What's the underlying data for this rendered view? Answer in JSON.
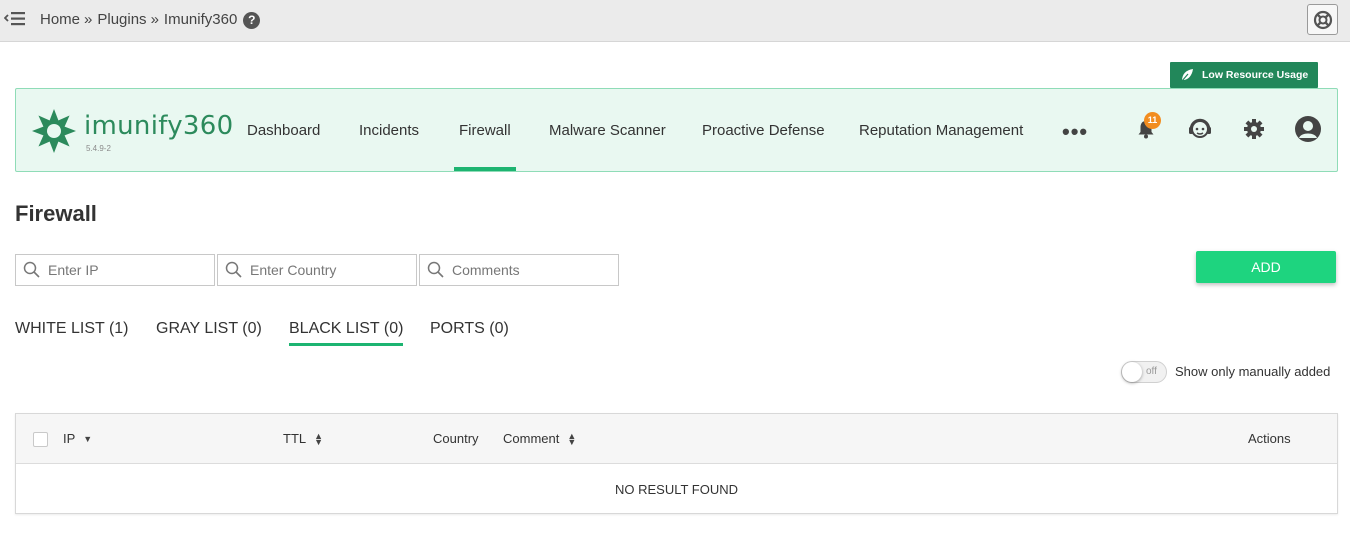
{
  "breadcrumb": {
    "home": "Home",
    "sep": "»",
    "plugins": "Plugins",
    "current": "Imunify360"
  },
  "help_icon_glyph": "?",
  "low_resource": {
    "label": "Low Resource Usage"
  },
  "logo": {
    "name": "imunify360",
    "version": "5.4.9-2"
  },
  "nav": {
    "items": [
      "Dashboard",
      "Incidents",
      "Firewall",
      "Malware Scanner",
      "Proactive Defense",
      "Reputation Management"
    ],
    "active": "Firewall",
    "more": "•••",
    "notifications_count": "11"
  },
  "page": {
    "title": "Firewall"
  },
  "filters": {
    "ip_placeholder": "Enter IP",
    "country_placeholder": "Enter Country",
    "comments_placeholder": "Comments"
  },
  "add_button": "ADD",
  "tabs": [
    "WHITE LIST (1)",
    "GRAY LIST (0)",
    "BLACK LIST (0)",
    "PORTS (0)"
  ],
  "active_tab": "BLACK LIST (0)",
  "toggle": {
    "state": "off",
    "label": "Show only manually added"
  },
  "table": {
    "columns": [
      "IP",
      "TTL",
      "Country",
      "Comment",
      "Actions"
    ],
    "empty_message": "NO RESULT FOUND"
  },
  "colors": {
    "accent": "#1db471",
    "add_button": "#1ed47f",
    "lru_badge": "#22875a",
    "nav_bg": "#e9f8f1",
    "notification": "#f28d20"
  }
}
